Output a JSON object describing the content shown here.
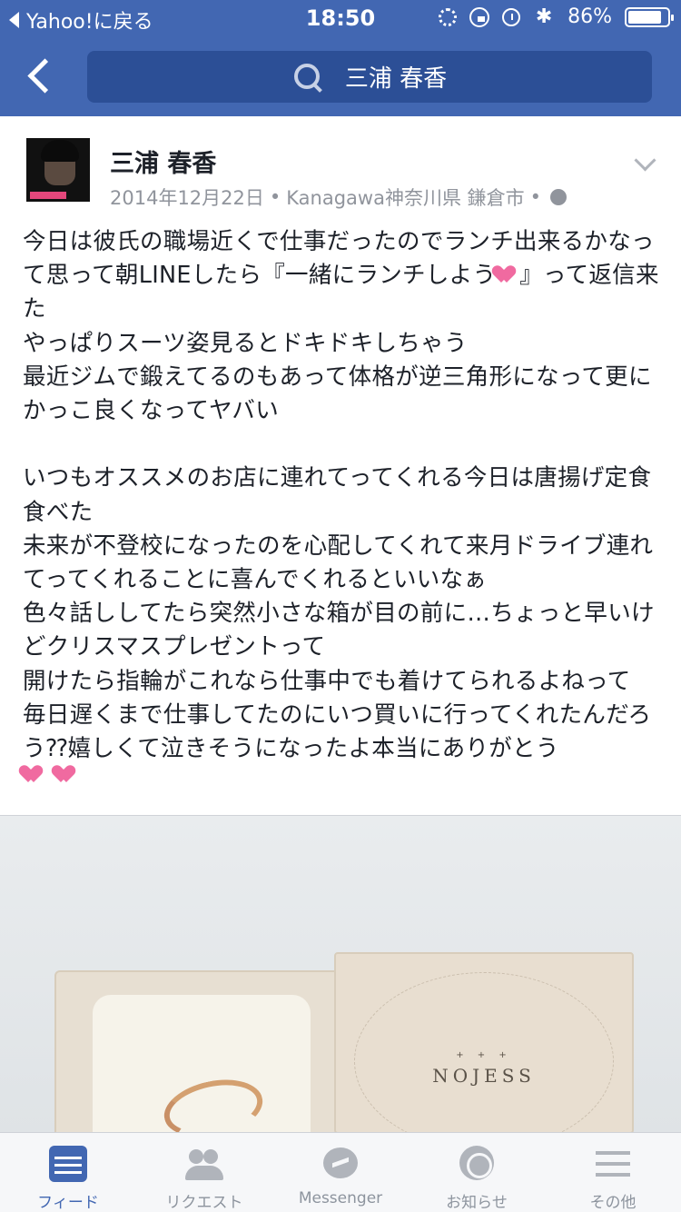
{
  "status_bar": {
    "back_app": "Yahoo!に戻る",
    "time": "18:50",
    "battery_percent": "86%",
    "battery_level": 0.86
  },
  "nav": {
    "search_text": "三浦 春香"
  },
  "post": {
    "author": "三浦 春香",
    "date": "2014年12月22日",
    "location": "Kanagawa神奈川県 鎌倉市",
    "text_part1": "今日は彼氏の職場近くで仕事だったのでランチ出来るかなって思って朝LINEしたら『一緒にランチしよう",
    "text_part2": "』って返信来た\nやっぱりスーツ姿見るとドキドキしちゃう\n最近ジムで鍛えてるのもあって体格が逆三角形になって更にかっこ良くなってヤバい\n\nいつもオススメのお店に連れてってくれる今日は唐揚げ定食食べた\n未来が不登校になったのを心配してくれて来月ドライブ連れてってくれることに喜んでくれるといいなぁ\n色々話ししてたら突然小さな箱が目の前に…ちょっと早いけどクリスマスプレゼントって\n開けたら指輪がこれなら仕事中でも着けてられるよねって\n毎日遅くまで仕事してたのにいつ買いに行ってくれたんだろう⁇嬉しくて泣きそうになったよ本当にありがとう",
    "photo_brand_text": "NOJESS",
    "photo_brand_mark": "+ + +"
  },
  "tabbar": {
    "tabs": [
      {
        "label": "フィード",
        "icon": "feed-icon",
        "active": true
      },
      {
        "label": "リクエスト",
        "icon": "friend-requests-icon",
        "active": false
      },
      {
        "label": "Messenger",
        "icon": "messenger-icon",
        "active": false
      },
      {
        "label": "お知らせ",
        "icon": "notifications-globe-icon",
        "active": false
      },
      {
        "label": "その他",
        "icon": "menu-icon",
        "active": false
      }
    ]
  },
  "colors": {
    "brand_blue": "#4267b2",
    "heart_pink": "#f06aa0"
  }
}
